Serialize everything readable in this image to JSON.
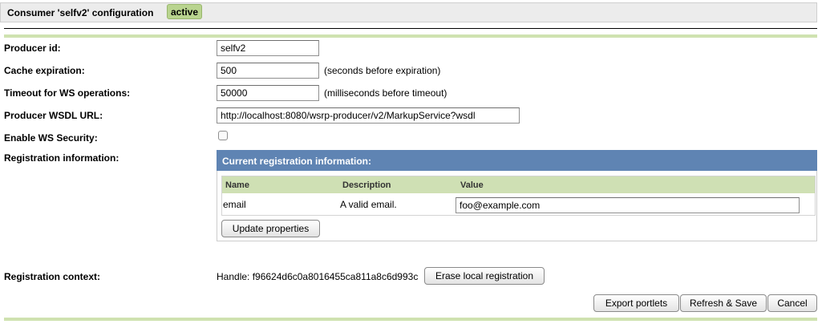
{
  "header": {
    "title": "Consumer 'selfv2' configuration",
    "status_badge": "active"
  },
  "form": {
    "producer_id": {
      "label": "Producer id:",
      "value": "selfv2"
    },
    "cache_expiration": {
      "label": "Cache expiration:",
      "value": "500",
      "hint": "(seconds before expiration)"
    },
    "timeout": {
      "label": "Timeout for WS operations:",
      "value": "50000",
      "hint": "(milliseconds before timeout)"
    },
    "wsdl_url": {
      "label": "Producer WSDL URL:",
      "value": "http://localhost:8080/wsrp-producer/v2/MarkupService?wsdl"
    },
    "ws_security": {
      "label": "Enable WS Security:",
      "checked": false
    },
    "registration_info": {
      "label": "Registration information:"
    },
    "registration_context": {
      "label": "Registration context:",
      "handle": "Handle: f96624d6c0a8016455ca811a8c6d993c"
    }
  },
  "registration_panel": {
    "title": "Current registration information:",
    "columns": [
      "Name",
      "Description",
      "Value"
    ],
    "rows": [
      {
        "name": "email",
        "description": "A valid email.",
        "value": "foo@example.com"
      }
    ],
    "update_button": "Update properties"
  },
  "buttons": {
    "erase_registration": "Erase local registration",
    "export_portlets": "Export portlets",
    "refresh_save": "Refresh & Save",
    "cancel": "Cancel"
  },
  "colors": {
    "badge": "#b9d48f",
    "panel_header": "#5f84b3",
    "table_header": "#cfe0b4",
    "rule_green": "#cfe2b0"
  }
}
